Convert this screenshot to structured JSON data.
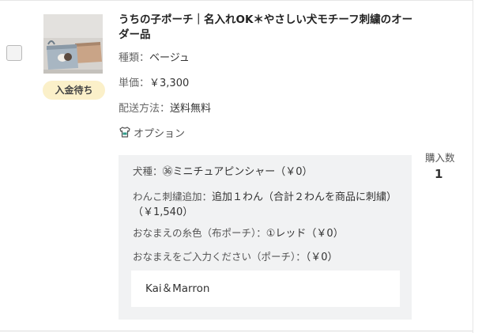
{
  "item": {
    "title": "うちの子ポーチ｜名入れOK＊やさしい犬モチーフ刺繍のオーダー品",
    "status_badge": "入金待ち",
    "type_label": "種類：",
    "type_value": "ベージュ",
    "price_label": "単価：",
    "price_value": "￥3,300",
    "shipping_label": "配送方法：",
    "shipping_value": "送料無料",
    "option_icon": "shirt-icon",
    "option_label": "オプション"
  },
  "options": [
    {
      "key": "犬種：",
      "value": "㊱ミニチュアピンシャー（￥0）"
    },
    {
      "key": "わんこ刺繍追加：",
      "value": "追加１わん（合計２わんを商品に刺繍）（￥1,540）"
    },
    {
      "key": "おなまえの糸色（布ポーチ）：",
      "value": "①レッド（￥0）"
    },
    {
      "key": "おなまえをご入力ください（ポーチ）：",
      "value": "（￥0）"
    }
  ],
  "name_input_value": "Kai＆Marron",
  "quantity": {
    "label": "購入数",
    "value": "1"
  },
  "colors": {
    "badge_bg": "#fbf0c9",
    "option_bg": "#f1f2f3"
  }
}
